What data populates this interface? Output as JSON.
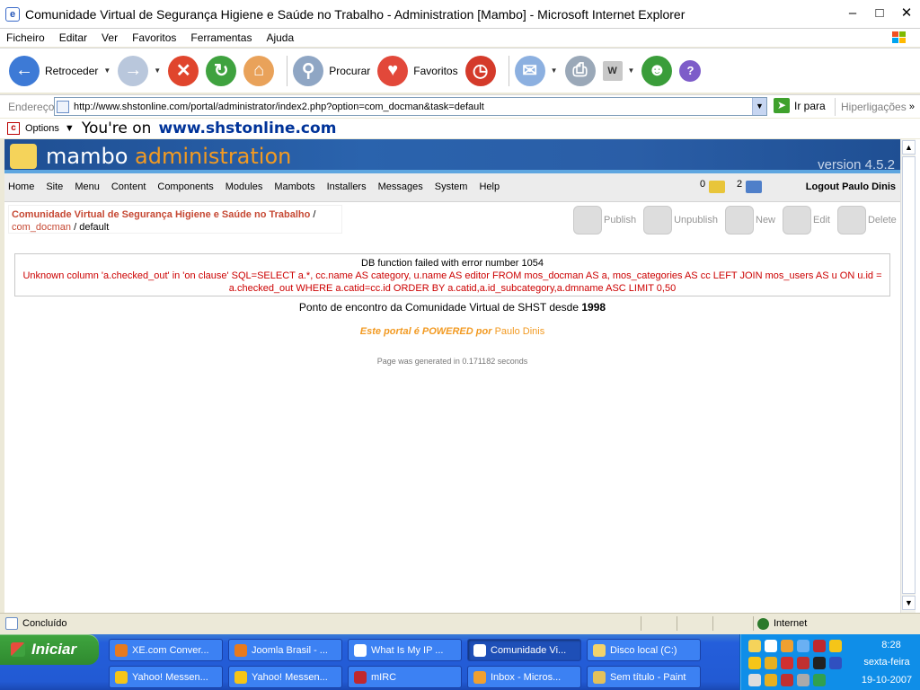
{
  "window": {
    "title": "Comunidade Virtual de Segurança Higiene e Saúde no Trabalho - Administration [Mambo] - Microsoft Internet Explorer",
    "ie_icon_glyph": "e"
  },
  "menubar": [
    "Ficheiro",
    "Editar",
    "Ver",
    "Favoritos",
    "Ferramentas",
    "Ajuda"
  ],
  "toolbar": {
    "back_label": "Retroceder",
    "search_label": "Procurar",
    "favorites_label": "Favoritos"
  },
  "addressbar": {
    "label": "Endereço",
    "url": "http://www.shstonline.com/portal/administrator/index2.php?option=com_docman&task=default",
    "go_label": "Ir para",
    "links_label": "Hiperligações"
  },
  "optionsbar": {
    "options_label": "Options",
    "youre_on": "You're on",
    "site": "www.shstonline.com"
  },
  "mambo": {
    "logo_text_1": "mambo",
    "logo_text_2": "administration",
    "version": "version 4.5.2",
    "menu": [
      "Home",
      "Site",
      "Menu",
      "Content",
      "Components",
      "Modules",
      "Mambots",
      "Installers",
      "Messages",
      "System",
      "Help"
    ],
    "messages_count": "0",
    "users_count": "2",
    "logout": "Logout Paulo Dinis",
    "pathway": {
      "site_title": "Comunidade Virtual de Segurança Higiene e Saúde no Trabalho",
      "sep": "/",
      "component": "com_docman",
      "task": "/ default"
    },
    "tools": [
      "Publish",
      "Unpublish",
      "New",
      "Edit",
      "Delete"
    ],
    "error_line1": "DB function failed with error number 1054",
    "error_line2": "Unknown column 'a.checked_out' in 'on clause' SQL=SELECT a.*, cc.name AS category, u.name AS editor FROM mos_docman AS a, mos_categories AS cc LEFT JOIN mos_users AS u ON u.id = a.checked_out WHERE a.catid=cc.id ORDER BY a.catid,a.id_subcategory,a.dmname ASC LIMIT 0,50",
    "ponto_text": "Ponto de encontro da Comunidade Virtual de SHST desde",
    "ponto_year": "1998",
    "powered_text": "Este portal é POWERED por",
    "powered_name": "Paulo Dinis",
    "generated": "Page was generated in 0.171182 seconds"
  },
  "statusbar": {
    "status": "Concluído",
    "zone": "Internet"
  },
  "taskbar": {
    "start_label": "Iniciar",
    "tasks_row1": [
      "XE.com Conver...",
      "Joomla Brasil - ...",
      "What Is My IP ...",
      "Comunidade Vi...",
      "Disco local (C:)"
    ],
    "tasks_row2": [
      "Yahoo! Messen...",
      "Yahoo! Messen...",
      "mIRC",
      "Inbox - Micros...",
      "Sem título - Paint"
    ],
    "time": "8:28",
    "day": "sexta-feira",
    "date": "19-10-2007"
  }
}
